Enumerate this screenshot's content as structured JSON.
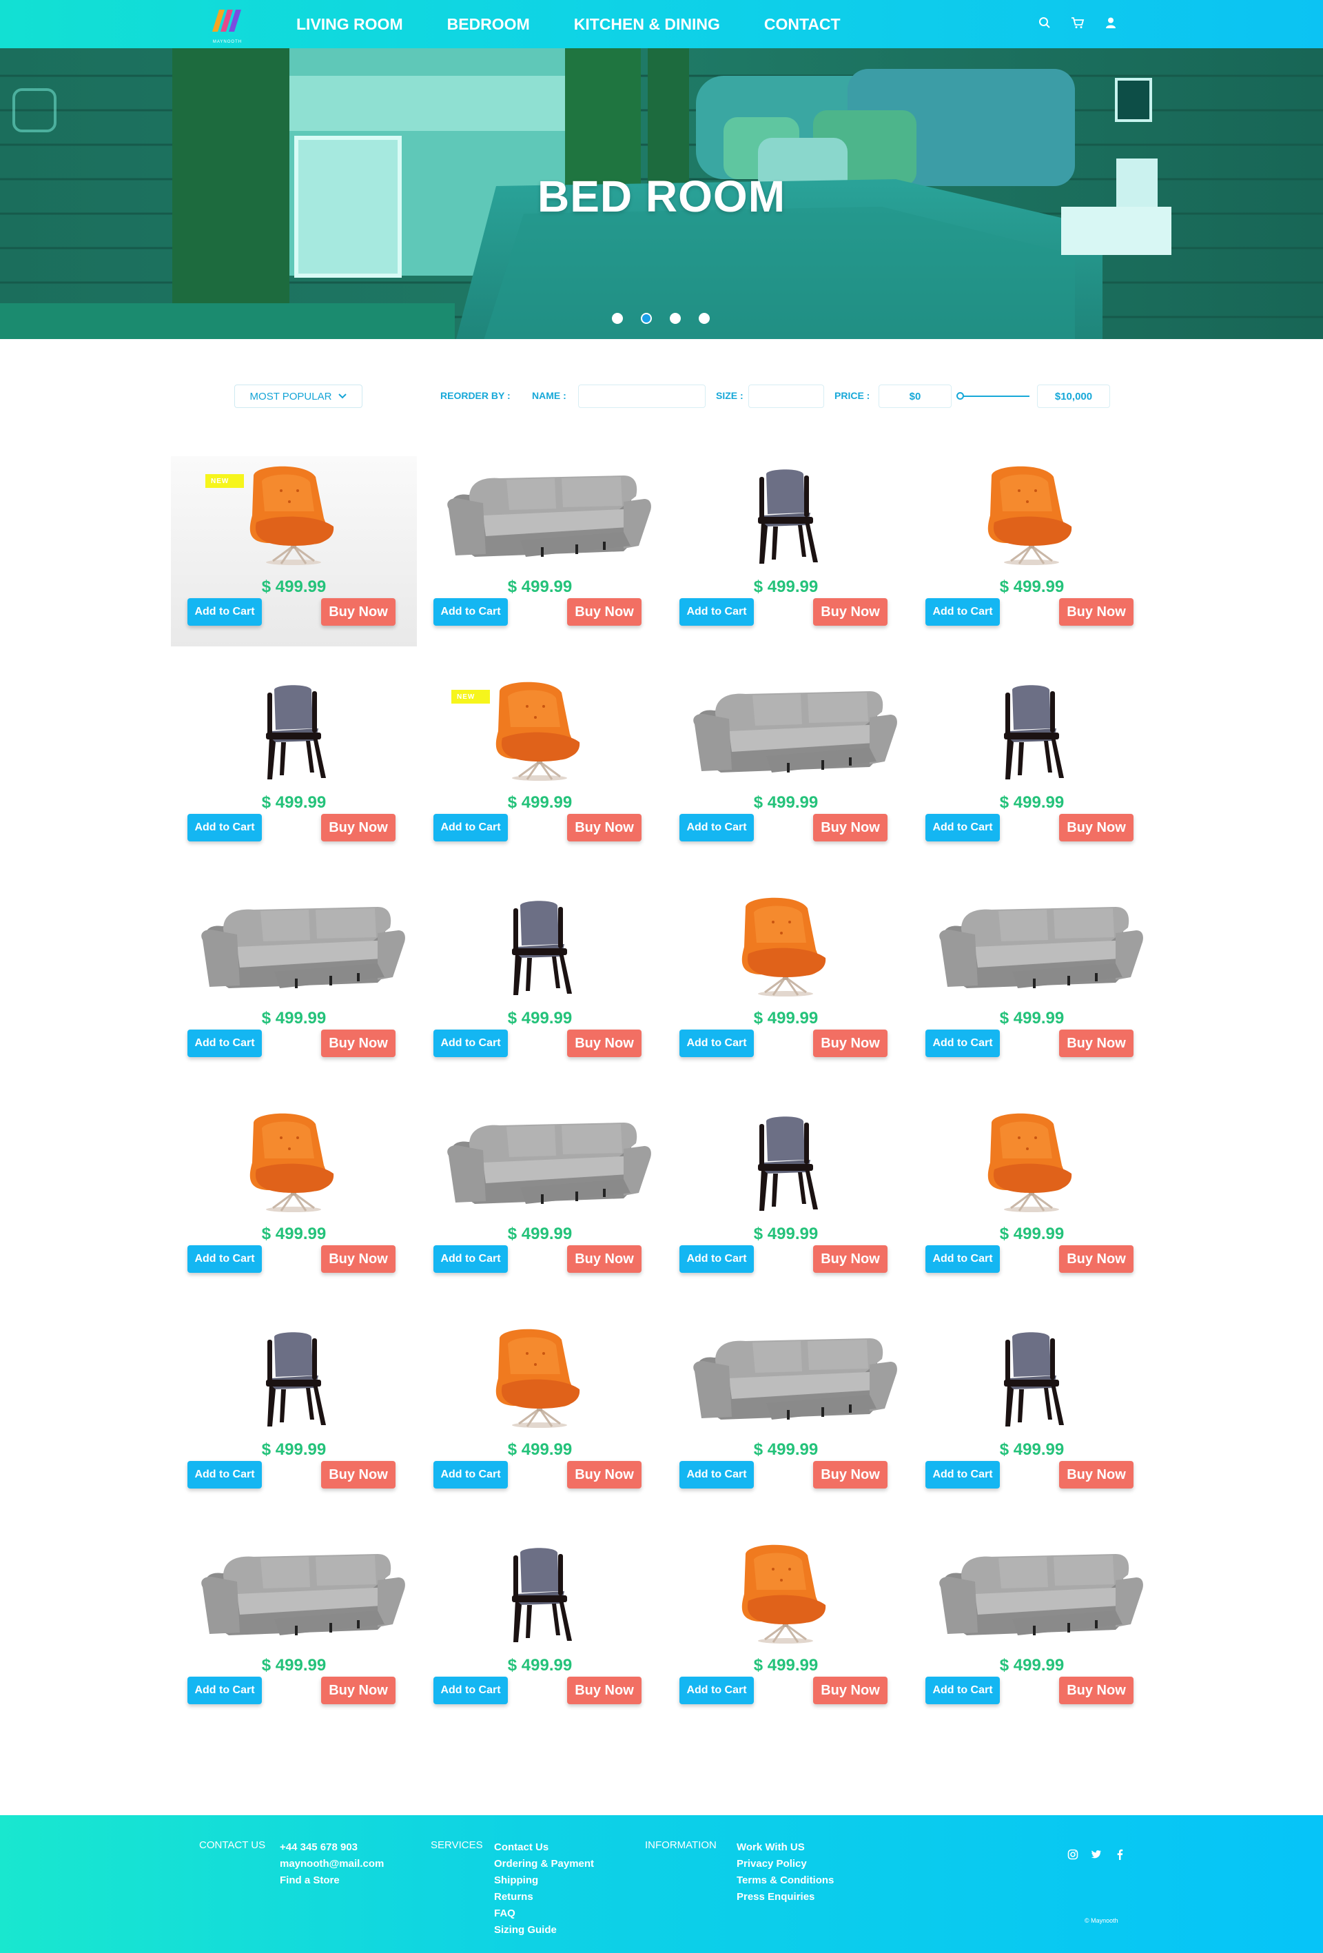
{
  "nav": {
    "brand": "MAYNOOTH",
    "links": [
      "LIVING ROOM",
      "BEDROOM",
      "KITCHEN & DINING",
      "CONTACT"
    ],
    "icons": [
      "search-icon",
      "cart-icon",
      "user-icon"
    ]
  },
  "hero": {
    "title": "BED ROOM",
    "slides": 4,
    "active_slide": 2
  },
  "filter": {
    "sort_label": "MOST POPULAR",
    "reorder_label": "REORDER BY :",
    "name_label": "NAME :",
    "name_value": "",
    "size_label": "SIZE :",
    "size_value": "",
    "price_label": "PRICE :",
    "price_min": "$0",
    "price_max": "$10,000"
  },
  "products": {
    "new_badge": "NEW",
    "add_to_cart": "Add to Cart",
    "buy_now": "Buy Now",
    "items": [
      {
        "kind": "lounge",
        "price": "$ 499.99",
        "is_new": true
      },
      {
        "kind": "sofa",
        "price": "$ 499.99",
        "is_new": false
      },
      {
        "kind": "chair",
        "price": "$ 499.99",
        "is_new": false
      },
      {
        "kind": "lounge",
        "price": "$ 499.99",
        "is_new": false
      },
      {
        "kind": "chair",
        "price": "$ 499.99",
        "is_new": false
      },
      {
        "kind": "lounge",
        "price": "$ 499.99",
        "is_new": true
      },
      {
        "kind": "sofa",
        "price": "$ 499.99",
        "is_new": false
      },
      {
        "kind": "chair",
        "price": "$ 499.99",
        "is_new": false
      },
      {
        "kind": "sofa",
        "price": "$ 499.99",
        "is_new": false
      },
      {
        "kind": "chair",
        "price": "$ 499.99",
        "is_new": false
      },
      {
        "kind": "lounge",
        "price": "$ 499.99",
        "is_new": false
      },
      {
        "kind": "sofa",
        "price": "$ 499.99",
        "is_new": false
      },
      {
        "kind": "lounge",
        "price": "$ 499.99",
        "is_new": false
      },
      {
        "kind": "sofa",
        "price": "$ 499.99",
        "is_new": false
      },
      {
        "kind": "chair",
        "price": "$ 499.99",
        "is_new": false
      },
      {
        "kind": "lounge",
        "price": "$ 499.99",
        "is_new": false
      },
      {
        "kind": "chair",
        "price": "$ 499.99",
        "is_new": false
      },
      {
        "kind": "lounge",
        "price": "$ 499.99",
        "is_new": false
      },
      {
        "kind": "sofa",
        "price": "$ 499.99",
        "is_new": false
      },
      {
        "kind": "chair",
        "price": "$ 499.99",
        "is_new": false
      },
      {
        "kind": "sofa",
        "price": "$ 499.99",
        "is_new": false
      },
      {
        "kind": "chair",
        "price": "$ 499.99",
        "is_new": false
      },
      {
        "kind": "lounge",
        "price": "$ 499.99",
        "is_new": false
      },
      {
        "kind": "sofa",
        "price": "$ 499.99",
        "is_new": false
      }
    ]
  },
  "footer": {
    "contact_title": "CONTACT US",
    "contact": [
      "+44 345 678 903",
      "maynooth@mail.com",
      "Find a Store"
    ],
    "services_title": "SERVICES",
    "services": [
      "Contact Us",
      "Ordering & Payment",
      "Shipping",
      "Returns",
      "FAQ",
      "Sizing Guide"
    ],
    "info_title": "INFORMATION",
    "info": [
      "Work With US",
      "Privacy Policy",
      "Terms & Conditions",
      "Press Enquiries"
    ],
    "social": [
      "instagram-icon",
      "twitter-icon",
      "facebook-icon"
    ],
    "copyright": "© Maynooth"
  }
}
